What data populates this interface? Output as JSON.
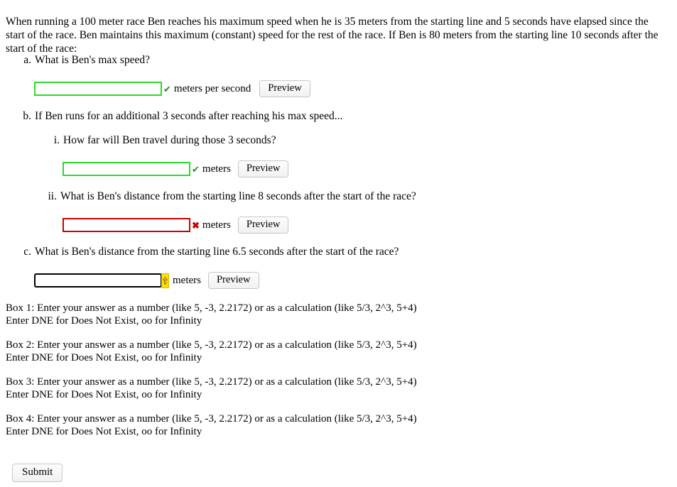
{
  "problem": {
    "intro": "When running a 100 meter race Ben reaches his maximum speed when he is 35 meters from the starting line and 5 seconds have elapsed since the start of the race. Ben maintains this maximum (constant) speed for the rest of the race. If Ben is 80 meters from the starting line 10 seconds after the start of the race:"
  },
  "questions": [
    {
      "marker": "a.",
      "text": "What is Ben's max speed?",
      "answer_value": "",
      "status": "correct",
      "status_icon": "green-check-icon",
      "status_symbol": "✔",
      "unit": "meters per second",
      "preview_label": "Preview"
    },
    {
      "marker": "b.",
      "text": "If Ben runs for an additional 3 seconds after reaching his max speed..."
    },
    {
      "marker": "i.",
      "text": "How far will Ben travel during those 3 seconds?",
      "answer_value": "",
      "status": "correct",
      "status_icon": "green-check-icon",
      "status_symbol": "✔",
      "unit": "meters",
      "preview_label": "Preview"
    },
    {
      "marker": "ii.",
      "text": "What is Ben's distance from the starting line 8 seconds after the start of the race?",
      "answer_value": "",
      "status": "incorrect",
      "status_icon": "red-cross-icon",
      "status_symbol": "✖",
      "unit": "meters",
      "preview_label": "Preview"
    },
    {
      "marker": "c.",
      "text": "What is Ben's distance from the starting line 6.5 seconds after the start of the race?",
      "answer_value": "",
      "status": "pending",
      "status_icon": "yellow-arrow-badge-icon",
      "unit": "meters",
      "preview_label": "Preview"
    }
  ],
  "box_help": [
    {
      "line1": "Box 1: Enter your answer as a number (like 5, -3, 2.2172) or as a calculation (like 5/3, 2^3, 5+4)",
      "line2": "Enter DNE for Does Not Exist, oo for Infinity"
    },
    {
      "line1": "Box 2: Enter your answer as a number (like 5, -3, 2.2172) or as a calculation (like 5/3, 2^3, 5+4)",
      "line2": "Enter DNE for Does Not Exist, oo for Infinity"
    },
    {
      "line1": "Box 3: Enter your answer as a number (like 5, -3, 2.2172) or as a calculation (like 5/3, 2^3, 5+4)",
      "line2": "Enter DNE for Does Not Exist, oo for Infinity"
    },
    {
      "line1": "Box 4: Enter your answer as a number (like 5, -3, 2.2172) or as a calculation (like 5/3, 2^3, 5+4)",
      "line2": "Enter DNE for Does Not Exist, oo for Infinity"
    }
  ],
  "submit": {
    "label": "Submit"
  },
  "colors": {
    "correct": "#2ed82e",
    "incorrect": "#cc0000",
    "pending": "#ffe000",
    "check_mark": "#1a8f1a"
  }
}
